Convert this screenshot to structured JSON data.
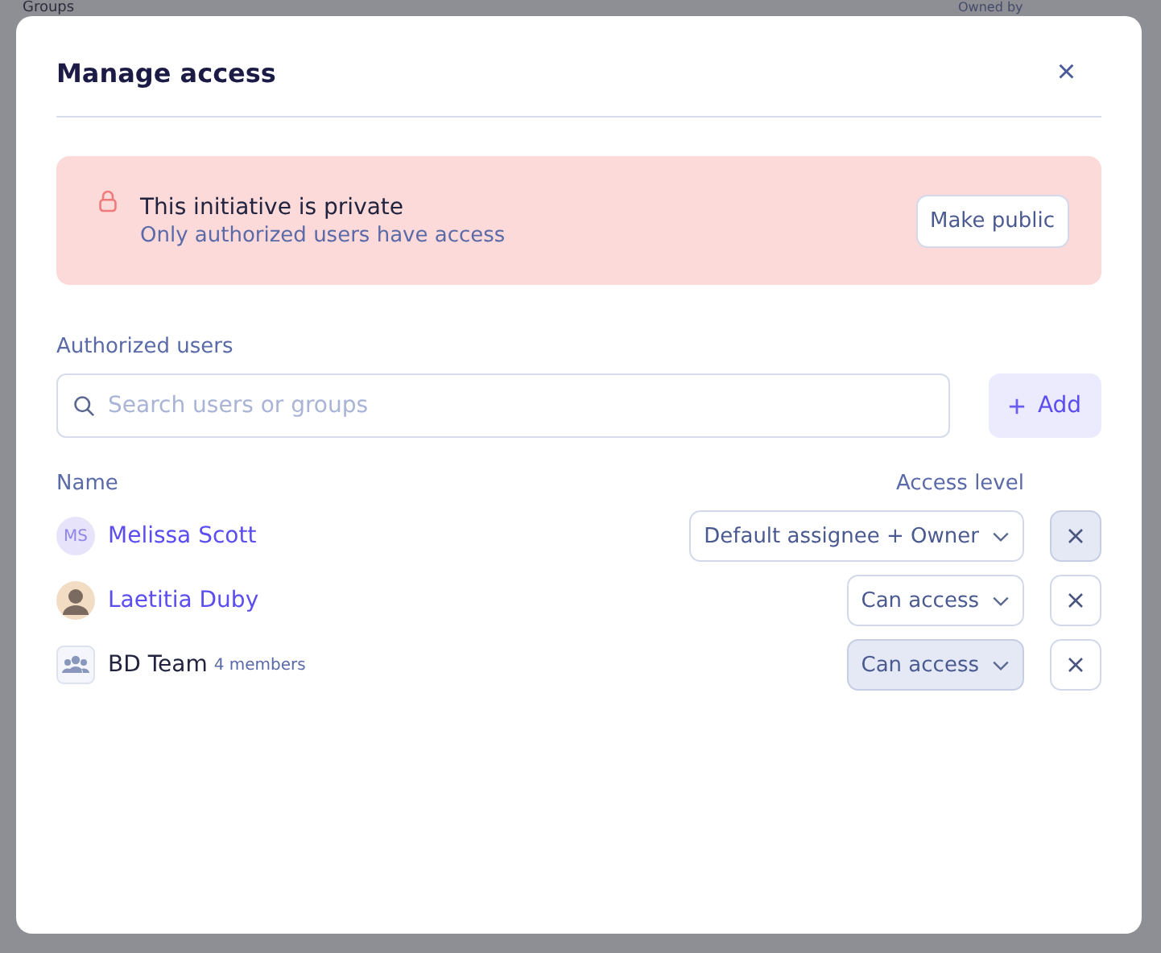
{
  "background": {
    "section_title": "Groups",
    "owner_label": "Owned by"
  },
  "dialog": {
    "title": "Manage access",
    "close": "×",
    "banner": {
      "title": "This initiative is private",
      "subtitle": "Only authorized users have access",
      "button": "Make public"
    },
    "section_label": "Authorized users",
    "search": {
      "placeholder": "Search users or groups"
    },
    "add_button": "Add",
    "columns": [
      "Name",
      "Access level"
    ],
    "rows": [
      {
        "kind": "initials",
        "initials": "MS",
        "name": "Melissa Scott",
        "access": "Default assignee + Owner",
        "access_highlighted": false,
        "remove_highlighted": true
      },
      {
        "kind": "photo",
        "name": "Laetitia Duby",
        "access": "Can access",
        "access_highlighted": false,
        "remove_highlighted": false
      },
      {
        "kind": "group",
        "name": "BD Team",
        "members": "4 members",
        "access": "Can access",
        "access_highlighted": true,
        "remove_highlighted": false
      }
    ]
  }
}
